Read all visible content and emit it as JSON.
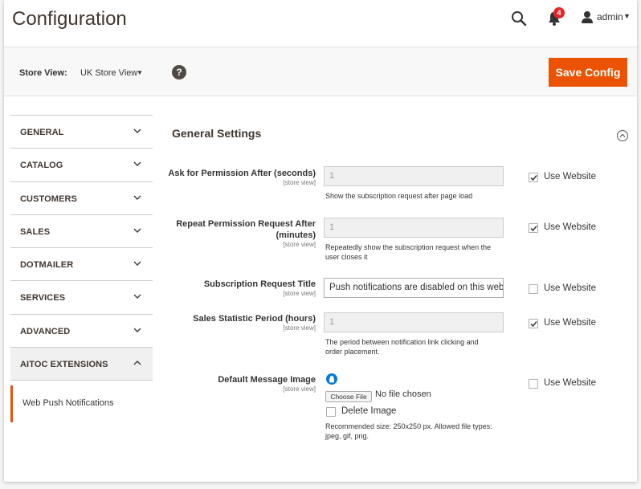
{
  "header": {
    "title": "Configuration",
    "notification_count": "4",
    "user": "admin"
  },
  "store_bar": {
    "label": "Store View:",
    "value": "UK Store View",
    "help": "?",
    "save_label": "Save Config"
  },
  "sidebar": {
    "items": [
      {
        "label": "GENERAL"
      },
      {
        "label": "CATALOG"
      },
      {
        "label": "CUSTOMERS"
      },
      {
        "label": "SALES"
      },
      {
        "label": "DOTMAILER"
      },
      {
        "label": "SERVICES"
      },
      {
        "label": "ADVANCED"
      },
      {
        "label": "AITOC EXTENSIONS"
      }
    ],
    "sub_item": "Web Push Notifications"
  },
  "section": {
    "title": "General Settings"
  },
  "fields": {
    "ask_permission": {
      "label": "Ask for Permission After (seconds)",
      "scope": "[store view]",
      "value": "1",
      "note": "Show the subscription request after page load",
      "use_website": "Use Website"
    },
    "repeat_permission": {
      "label_line1": "Repeat Permission Request After",
      "label_line2": "(minutes)",
      "scope": "[store view]",
      "value": "1",
      "note_line1": "Repeatedly show the subscription request when the",
      "note_line2": "user closes it",
      "use_website": "Use Website"
    },
    "subscription_title": {
      "label": "Subscription Request Title",
      "scope": "[store view]",
      "value": "Push notifications are disabled on this web",
      "use_website": "Use Website"
    },
    "sales_period": {
      "label": "Sales Statistic Period (hours)",
      "scope": "[store view]",
      "value": "1",
      "note_line1": "The period between notification link clicking and",
      "note_line2": "order placement.",
      "use_website": "Use Website"
    },
    "default_image": {
      "label": "Default Message Image",
      "scope": "[store view]",
      "choose_file": "Choose File",
      "no_file": "No file chosen",
      "delete_label": "Delete Image",
      "note_line1": "Recommended size: 250x250 px. Allowed file types:",
      "note_line2": "jpeg, gif, png.",
      "use_website": "Use Website"
    }
  },
  "colors": {
    "accent": "#eb5202",
    "badge": "#e22626",
    "upload_icon": "#007bdb"
  }
}
